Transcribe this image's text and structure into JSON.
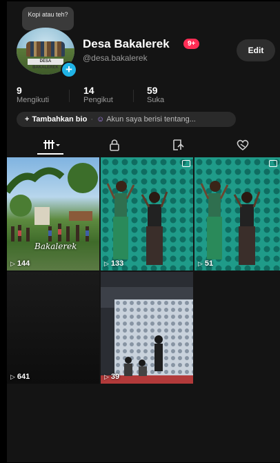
{
  "profile": {
    "note": "Kopi atau teh?",
    "display_name": "Desa Bakalerek",
    "notification_count": "9+",
    "username": "@desa.bakalerek",
    "edit_label": "Edit",
    "avatar_banner": "DESA BAKALEREK"
  },
  "stats": {
    "following_count": "9",
    "following_label": "Mengikuti",
    "followers_count": "14",
    "followers_label": "Pengikut",
    "likes_count": "59",
    "likes_label": "Suka"
  },
  "bio": {
    "add_label": "Tambahkan bio",
    "prompt": "Akun saya berisi tentang..."
  },
  "tabs": [
    "videos-grid-icon",
    "lock-icon",
    "repost-icon",
    "liked-heart-icon"
  ],
  "videos": [
    {
      "views": "144",
      "caption": "Bakalerek"
    },
    {
      "views": "133"
    },
    {
      "views": "51"
    },
    {
      "views": "641"
    },
    {
      "views": "39"
    }
  ],
  "colors": {
    "badge_red": "#ff2d55",
    "add_blue": "#20b3e6",
    "bio_purple": "#b28cff",
    "background": "#141414"
  }
}
